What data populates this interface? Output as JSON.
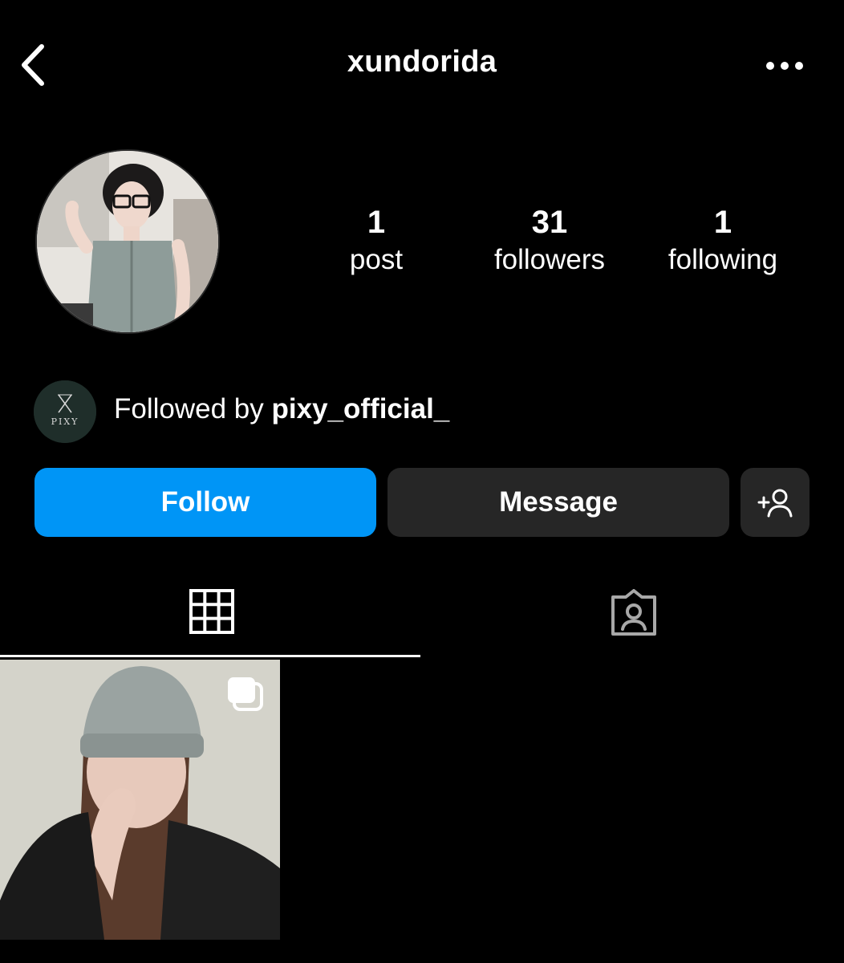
{
  "header": {
    "username": "xundorida"
  },
  "stats": {
    "posts": {
      "count": "1",
      "label": "post"
    },
    "followers": {
      "count": "31",
      "label": "followers"
    },
    "following": {
      "count": "1",
      "label": "following"
    }
  },
  "followed_by": {
    "prefix": "Followed by",
    "account": "pixy_official_",
    "avatar_logo_text": "PIXY"
  },
  "actions": {
    "follow_label": "Follow",
    "message_label": "Message"
  },
  "colors": {
    "background": "#000000",
    "follow_button": "#0095f6",
    "secondary_button": "#262626"
  },
  "icons": {
    "back": "chevron-left-icon",
    "more": "more-horizontal-icon",
    "add_person": "add-person-icon",
    "grid_tab": "grid-icon",
    "tagged_tab": "tagged-person-icon",
    "carousel": "multiple-images-icon"
  }
}
